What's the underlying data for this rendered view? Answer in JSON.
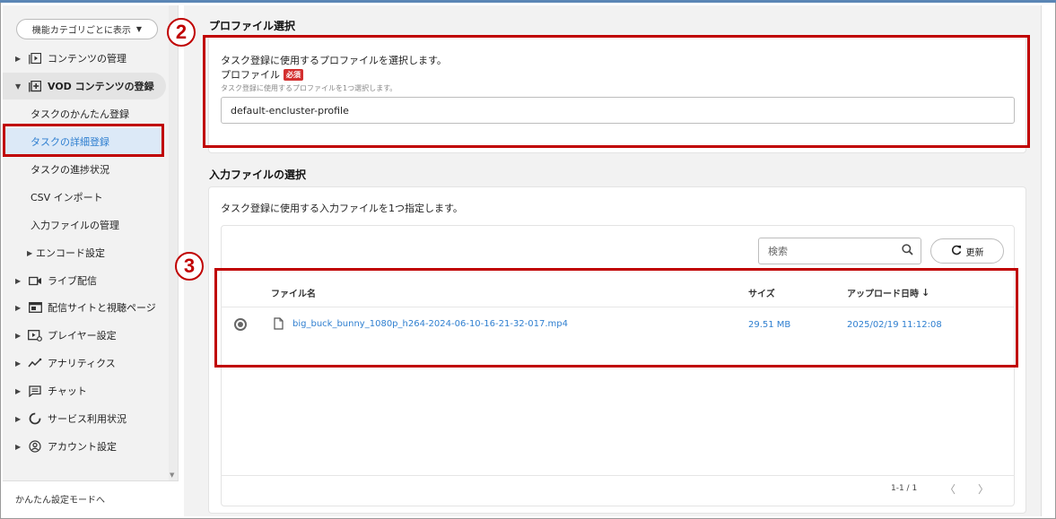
{
  "sidebar": {
    "view_select": "機能カテゴリごとに表示",
    "items": [
      {
        "label": "コンテンツの管理"
      },
      {
        "label": "VOD コンテンツの登録"
      },
      {
        "label": "タスクのかんたん登録"
      },
      {
        "label": "タスクの詳細登録"
      },
      {
        "label": "タスクの進捗状況"
      },
      {
        "label": "CSV インポート"
      },
      {
        "label": "入力ファイルの管理"
      },
      {
        "label": "エンコード設定"
      },
      {
        "label": "ライブ配信"
      },
      {
        "label": "配信サイトと視聴ページ"
      },
      {
        "label": "プレイヤー設定"
      },
      {
        "label": "アナリティクス"
      },
      {
        "label": "チャット"
      },
      {
        "label": "サービス利用状況"
      },
      {
        "label": "アカウント設定"
      }
    ],
    "footer": "かんたん設定モードへ"
  },
  "annotations": {
    "step2": "2",
    "step3": "3"
  },
  "profile_section": {
    "title": "プロファイル選択",
    "description": "タスク登録に使用するプロファイルを選択します。",
    "field_label": "プロファイル",
    "required_badge": "必須",
    "hint": "タスク登録に使用するプロファイルを1つ選択します。",
    "value": "default-encluster-profile"
  },
  "input_section": {
    "title": "入力ファイルの選択",
    "description": "タスク登録に使用する入力ファイルを1つ指定します。",
    "search_placeholder": "検索",
    "refresh_label": "更新",
    "columns": {
      "name": "ファイル名",
      "size": "サイズ",
      "uploaded": "アップロード日時"
    },
    "rows": [
      {
        "name": "big_buck_bunny_1080p_h264-2024-06-10-16-21-32-017.mp4",
        "size": "29.51 MB",
        "uploaded": "2025/02/19 11:12:08",
        "selected": true
      }
    ],
    "pager": {
      "range": "1-1 / 1",
      "prev": "〈",
      "next": "〉"
    }
  },
  "colors": {
    "accent": "#2f7fd0",
    "annotation_red": "#c00000",
    "required_red": "#d32f2f"
  }
}
